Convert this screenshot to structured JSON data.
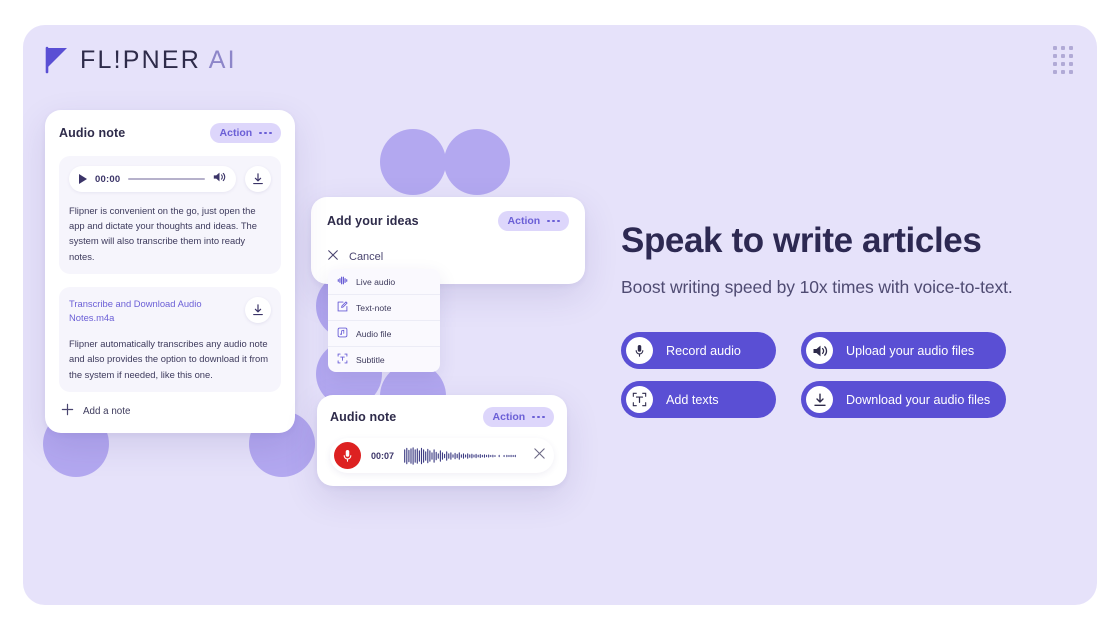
{
  "brand": {
    "name_main": "FL!PNER",
    "name_suffix": "AI",
    "logo_icon": "flag-mark-icon",
    "apps_grid_icon": "apps-grid-icon"
  },
  "cards": {
    "audio_note": {
      "title": "Audio note",
      "action_label": "Action",
      "player": {
        "play_icon": "play-icon",
        "time": "00:00",
        "volume_icon": "volume-icon",
        "download_icon": "download-icon"
      },
      "description": "Flipner is convenient on the go, just open the app and dictate your thoughts and ideas. The system will also transcribe them into ready notes.",
      "attachment": {
        "file_name": "Transcribe and Download Audio Notes.m4a",
        "download_icon": "download-icon",
        "description": "Flipner automatically transcribes any audio note and also provides the option to download it from the system if needed, like this one."
      },
      "add_note_label": "Add a note",
      "add_note_icon": "plus-icon"
    },
    "ideas": {
      "title": "Add your ideas",
      "action_label": "Action",
      "cancel_label": "Cancel",
      "cancel_icon": "close-icon",
      "menu": [
        {
          "label": "Live audio",
          "icon": "live-audio-icon"
        },
        {
          "label": "Text-note",
          "icon": "text-note-icon"
        },
        {
          "label": "Audio file",
          "icon": "audio-file-icon"
        },
        {
          "label": "Subtitle",
          "icon": "subtitle-icon"
        }
      ]
    },
    "recording": {
      "title": "Audio note",
      "action_label": "Action",
      "record_icon": "microphone-icon",
      "time": "00:07",
      "waveform_icon": "waveform-icon",
      "close_icon": "close-icon"
    }
  },
  "hero": {
    "headline": "Speak to write articles",
    "subheadline": "Boost writing speed by 10x times with voice-to-text.",
    "buttons": [
      {
        "label": "Record audio",
        "icon": "microphone-icon"
      },
      {
        "label": "Upload your audio files",
        "icon": "volume-icon"
      },
      {
        "label": "Add texts",
        "icon": "text-select-icon"
      },
      {
        "label": "Download your audio files",
        "icon": "download-icon"
      }
    ]
  },
  "colors": {
    "panel_bg": "#e6e2fa",
    "circle": "#b3a8f0",
    "accent": "#5a4fd4",
    "badge_bg": "#ddd6fb",
    "badge_text": "#6b5fd6",
    "record_red": "#dd2121",
    "headline": "#2d2952"
  }
}
